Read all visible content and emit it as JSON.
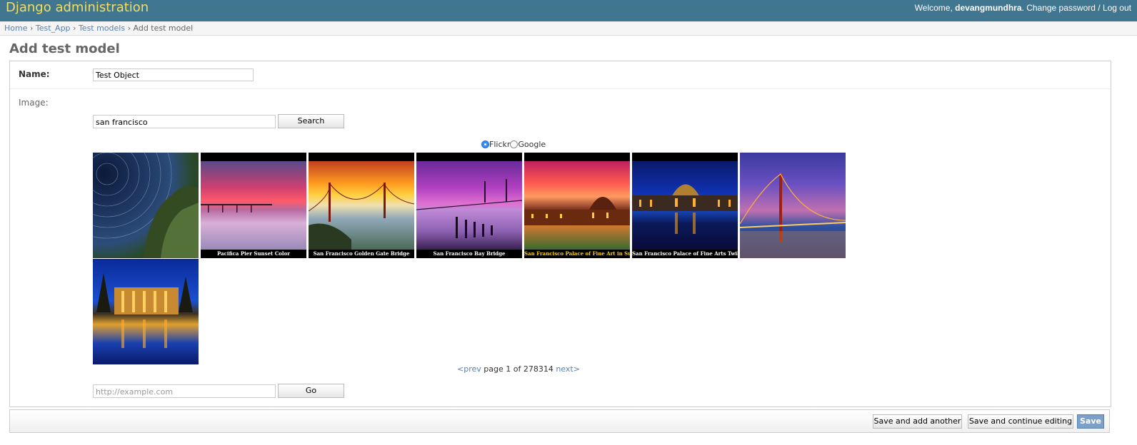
{
  "header": {
    "brand": "Django administration",
    "welcome_prefix": "Welcome,",
    "username": "devangmundhra",
    "change_password": "Change password",
    "separator": "/",
    "logout": "Log out"
  },
  "breadcrumbs": {
    "home": "Home",
    "app": "Test_App",
    "model": "Test models",
    "current": "Add test model",
    "sep": "›"
  },
  "page_title": "Add test model",
  "form": {
    "name_label": "Name:",
    "name_value": "Test Object",
    "image_label": "Image:",
    "search_value": "san francisco",
    "search_button": "Search",
    "radio": {
      "flickr_label": "Flickr",
      "google_label": "Google",
      "selected": "Flickr"
    },
    "results": [
      {
        "caption": "",
        "theme": "star-trails"
      },
      {
        "caption": "Pacifica Pier Sunset Color",
        "theme": "pink-sunset-pier"
      },
      {
        "caption": "San Francisco Golden Gate Bridge",
        "theme": "golden-fog-bridge"
      },
      {
        "caption": "San Francisco Bay Bridge",
        "theme": "purple-bay-bridge"
      },
      {
        "caption": "San Francisco Palace of Fine Art in Sunset Color",
        "theme": "palace-sunset"
      },
      {
        "caption": "San Francisco Palace of Fine Arts Twilight Blue Moment",
        "theme": "palace-blue"
      },
      {
        "caption": "",
        "theme": "golden-gate-night"
      },
      {
        "caption": "",
        "theme": "palace-night-reflection"
      }
    ],
    "pager": {
      "prev": "<prev",
      "text": "page 1 of 278314",
      "next": "next>"
    },
    "url_placeholder": "http://example.com",
    "go_button": "Go"
  },
  "submit": {
    "save_add_another": "Save and add another",
    "save_continue": "Save and continue editing",
    "save": "Save"
  },
  "colors": {
    "header_bg": "#417690",
    "brand": "#f5dd5d",
    "link": "#5b80b2"
  }
}
